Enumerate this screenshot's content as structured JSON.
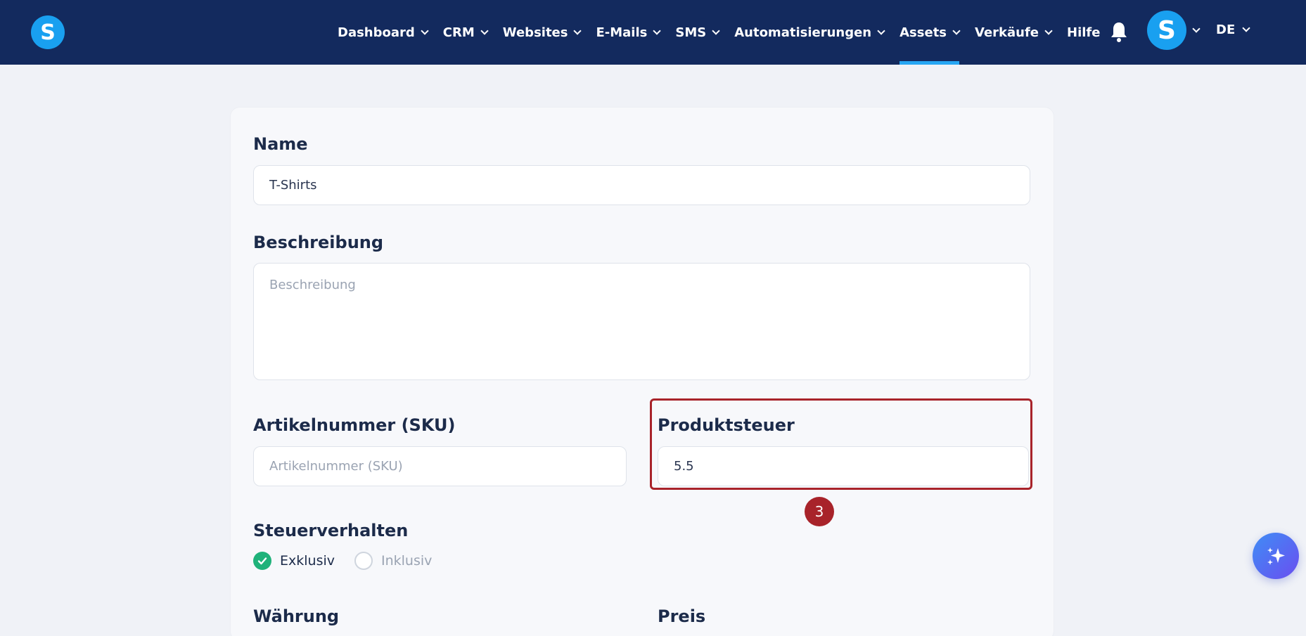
{
  "brand": {
    "logo_letter": "S"
  },
  "nav": {
    "items": [
      {
        "label": "Dashboard",
        "has_dropdown": true
      },
      {
        "label": "CRM",
        "has_dropdown": true
      },
      {
        "label": "Websites",
        "has_dropdown": true
      },
      {
        "label": "E-Mails",
        "has_dropdown": true
      },
      {
        "label": "SMS",
        "has_dropdown": true
      },
      {
        "label": "Automatisierungen",
        "has_dropdown": true
      },
      {
        "label": "Assets",
        "has_dropdown": true,
        "active": true
      },
      {
        "label": "Verkäufe",
        "has_dropdown": true
      },
      {
        "label": "Hilfe",
        "has_dropdown": false
      }
    ],
    "avatar_letter": "S",
    "language": "DE"
  },
  "form": {
    "name": {
      "label": "Name",
      "value": "T-Shirts"
    },
    "description": {
      "label": "Beschreibung",
      "placeholder": "Beschreibung"
    },
    "sku": {
      "label": "Artikelnummer (SKU)",
      "placeholder": "Artikelnummer (SKU)"
    },
    "tax": {
      "label": "Produktsteuer",
      "value": "5.5"
    },
    "tax_behavior": {
      "label": "Steuerverhalten",
      "options": [
        "Exklusiv",
        "Inklusiv"
      ],
      "selected": "Exklusiv"
    },
    "currency": {
      "label": "Währung"
    },
    "price": {
      "label": "Preis"
    }
  },
  "annotation": {
    "step_number": "3"
  },
  "colors": {
    "topbar": "#132a5e",
    "accent": "#27a6f3",
    "highlight": "#a8232a",
    "checked": "#1fb27a"
  }
}
